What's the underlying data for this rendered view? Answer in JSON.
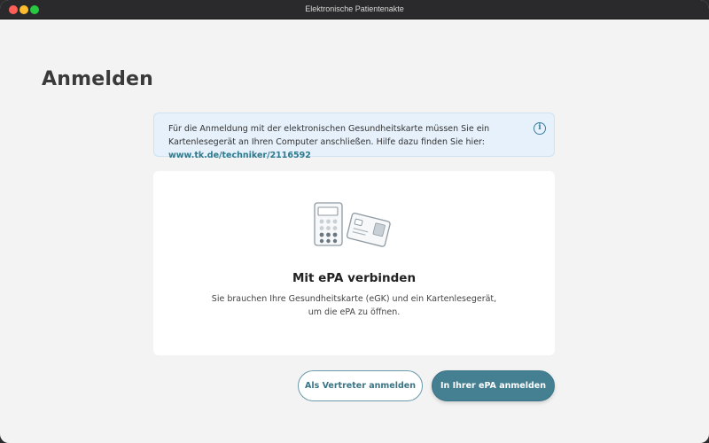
{
  "window": {
    "title": "Elektronische Patientenakte"
  },
  "page": {
    "title": "Anmelden"
  },
  "info": {
    "text": "Für die Anmeldung mit der elektronischen Gesundheitskarte müssen Sie ein Kartenlesegerät an Ihren Computer anschließen. Hilfe dazu finden Sie hier:",
    "link": "www.tk.de/techniker/2116592",
    "icon": "info-icon"
  },
  "card": {
    "illustration": "card-reader-illustration",
    "title": "Mit ePA verbinden",
    "text": "Sie brauchen Ihre Gesundheitskarte (eGK) und ein Kartenlesegerät, um die ePA zu öffnen."
  },
  "actions": {
    "secondary_label": "Als Vertreter anmelden",
    "primary_label": "In Ihrer ePA anmelden"
  },
  "colors": {
    "accent": "#447f92",
    "info_background": "#e6f1fb",
    "link": "#2f7a8c"
  }
}
